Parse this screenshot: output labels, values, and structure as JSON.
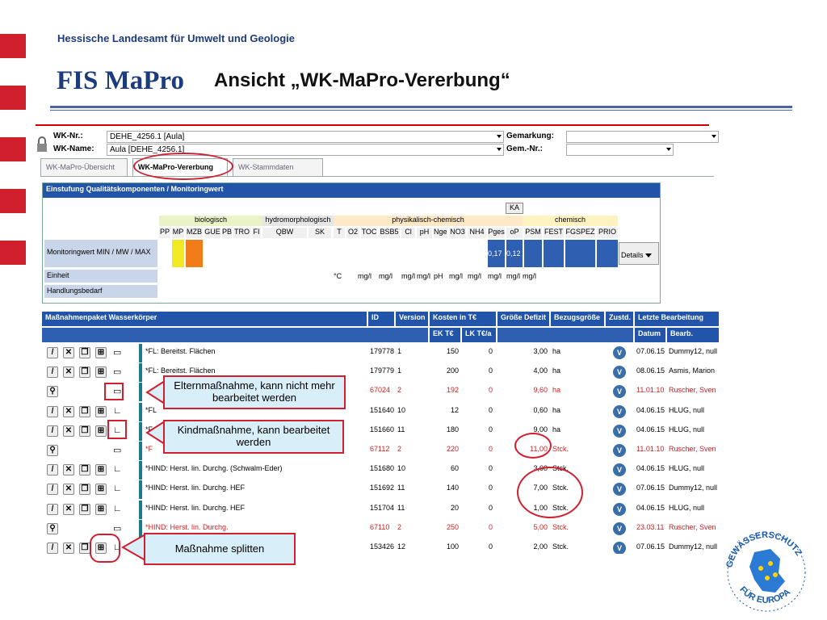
{
  "header": {
    "org": "Hessische Landesamt für Umwelt und Geologie",
    "app": "FIS MaPro",
    "view_title": "Ansicht „WK-MaPro-Vererbung“"
  },
  "filters": {
    "wk_nr_label": "WK-Nr.:",
    "wk_nr_value": "DEHE_4256.1 [Aula]",
    "wk_name_label": "WK-Name:",
    "wk_name_value": "Aula [DEHE_4256.1]",
    "gemarkung_label": "Gemarkung:",
    "gem_nr_label": "Gem.-Nr.:"
  },
  "tabs": [
    "WK-MaPro-Übersicht",
    "WK-MaPro-Vererbung",
    "WK-Stammdaten"
  ],
  "quality": {
    "title": "Einstufung Qualitätskomponenten / Monitoringwert",
    "ka": "KA",
    "groups": [
      "biologisch",
      "hydromorphologisch",
      "physikalisch-chemisch",
      "chemisch"
    ],
    "cols": [
      "PP",
      "MP",
      "MZB",
      "GUE",
      "PB",
      "TRO",
      "FI",
      "QBW",
      "SK",
      "T",
      "O2",
      "TOC",
      "BSB5",
      "Cl",
      "pH",
      "Nges",
      "NO3",
      "NH4",
      "Pges",
      "oP",
      "PSM",
      "FEST",
      "FGSPEZ",
      "PRIO"
    ],
    "row_monitoring": "Monitoringwert MIN / MW / MAX",
    "row_einheit": "Einheit",
    "row_handlung": "Handlungsbedarf",
    "pges_val": "0,17",
    "op_val": "0,12",
    "units": [
      "°C",
      "mg/l",
      "mg/l",
      "mg/l",
      "mg/l",
      "pH",
      "mg/l",
      "mg/l",
      "mg/l",
      "mg/l",
      "mg/l"
    ],
    "details": "Details"
  },
  "measures": {
    "title": "Maßnahmenpaket Wasserkörper",
    "col_id": "ID",
    "col_version": "Version",
    "col_kosten": "Kosten in T€",
    "col_ek": "EK T€",
    "col_lk": "LK T€/a",
    "col_defizit": "Größe Defizit",
    "col_bezug": "Bezugsgröße",
    "col_zustd": "Zustd.",
    "col_letzte": "Letzte Bearbeitung",
    "col_datum": "Datum",
    "col_bearb": "Bearb.",
    "rows": [
      {
        "name": "*FL: Bereitst. Flächen",
        "id": "179778",
        "ver": "1",
        "ek": "150",
        "lk": "0",
        "def": "3,00",
        "bez": "ha",
        "date": "07.06.15",
        "user": "Dummy12, null",
        "red": false
      },
      {
        "name": "*FL: Bereitst. Flächen",
        "id": "179779",
        "ver": "1",
        "ek": "200",
        "lk": "0",
        "def": "4,00",
        "bez": "ha",
        "date": "08.06.15",
        "user": "Asmis, Marion",
        "red": false
      },
      {
        "name": "",
        "id": "67024",
        "ver": "2",
        "ek": "192",
        "lk": "0",
        "def": "9,60",
        "bez": "ha",
        "date": "11.01.10",
        "user": "Ruscher, Sven",
        "red": true
      },
      {
        "name": "*FL",
        "id": "151640",
        "ver": "10",
        "ek": "12",
        "lk": "0",
        "def": "0,60",
        "bez": "ha",
        "date": "04.06.15",
        "user": "HLUG, null",
        "red": false
      },
      {
        "name": "*F",
        "id": "151660",
        "ver": "11",
        "ek": "180",
        "lk": "0",
        "def": "9,00",
        "bez": "ha",
        "date": "04.06.15",
        "user": "HLUG, null",
        "red": false
      },
      {
        "name": "*F",
        "id": "67112",
        "ver": "2",
        "ek": "220",
        "lk": "0",
        "def": "11,00",
        "bez": "Stck.",
        "date": "11.01.10",
        "user": "Ruscher, Sven",
        "red": true
      },
      {
        "name": "*HIND: Herst. lin. Durchg. (Schwalm-Eder)",
        "id": "151680",
        "ver": "10",
        "ek": "60",
        "lk": "0",
        "def": "3,00",
        "bez": "Stck.",
        "date": "04.06.15",
        "user": "HLUG, null",
        "red": false
      },
      {
        "name": "*HIND: Herst. lin. Durchg. HEF",
        "id": "151692",
        "ver": "11",
        "ek": "140",
        "lk": "0",
        "def": "7,00",
        "bez": "Stck.",
        "date": "07.06.15",
        "user": "Dummy12, null",
        "red": false
      },
      {
        "name": "*HIND: Herst. lin. Durchg. HEF",
        "id": "151704",
        "ver": "11",
        "ek": "20",
        "lk": "0",
        "def": "1,00",
        "bez": "Stck.",
        "date": "04.06.15",
        "user": "HLUG, null",
        "red": false
      },
      {
        "name": "*HIND: Herst. lin. Durchg.",
        "id": "67110",
        "ver": "2",
        "ek": "250",
        "lk": "0",
        "def": "5,00",
        "bez": "Stck.",
        "date": "23.03.11",
        "user": "Ruscher, Sven",
        "red": true
      },
      {
        "name": "",
        "id": "153426",
        "ver": "12",
        "ek": "100",
        "lk": "0",
        "def": "2,00",
        "bez": "Stck.",
        "date": "07.06.15",
        "user": "Dummy12, null",
        "red": false
      }
    ]
  },
  "callouts": {
    "eltern": "Elternmaßnahme, kann nicht mehr bearbeitet werden",
    "kind": "Kindmaßnahme, kann bearbeitet werden",
    "split": "Maßnahme splitten"
  },
  "logo": {
    "text": "GEWÄSSERSCHUTZ FÜR EUROPA"
  }
}
